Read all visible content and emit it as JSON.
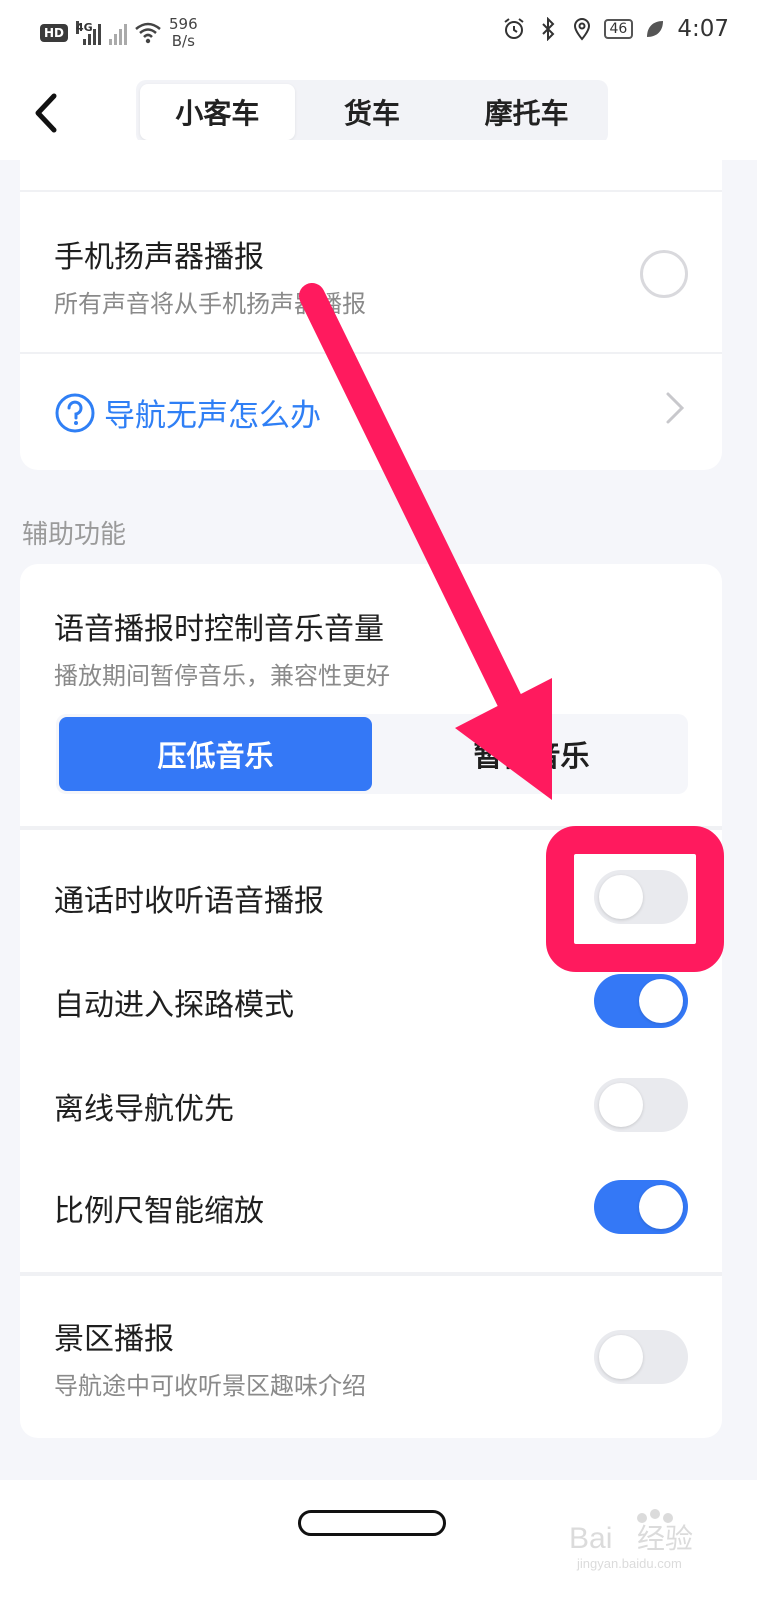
{
  "status_bar": {
    "hd_label": "HD",
    "network_label": "4G",
    "speed_value": "596",
    "speed_unit": "B/s",
    "battery": "46",
    "time": "4:07",
    "icons": [
      "alarm-icon",
      "bluetooth-icon",
      "location-icon",
      "battery-icon",
      "leaf-icon"
    ]
  },
  "header": {
    "tabs": [
      {
        "label": "小客车",
        "active": true
      },
      {
        "label": "货车",
        "active": false
      },
      {
        "label": "摩托车",
        "active": false
      }
    ]
  },
  "card_speaker": {
    "title": "手机扬声器播报",
    "subtitle": "所有声音将从手机扬声器播报",
    "selected": false,
    "help_link": "导航无声怎么办"
  },
  "section_label": "辅助功能",
  "volume_control": {
    "title": "语音播报时控制音乐音量",
    "subtitle": "播放期间暂停音乐，兼容性更好",
    "options": [
      {
        "label": "压低音乐",
        "active": true
      },
      {
        "label": "暂停音乐",
        "active": false
      }
    ]
  },
  "toggles": [
    {
      "label": "通话时收听语音播报",
      "on": false
    },
    {
      "label": "自动进入探路模式",
      "on": true
    },
    {
      "label": "离线导航优先",
      "on": false
    },
    {
      "label": "比例尺智能缩放",
      "on": true
    }
  ],
  "scenic": {
    "title": "景区播报",
    "subtitle": "导航途中可收听景区趣味介绍",
    "on": false
  },
  "watermark": {
    "brand": "Bai",
    "brand2": "经验",
    "url": "jingyan.baidu.com"
  },
  "colors": {
    "accent": "#3478f6",
    "annotation": "#ff1a5e",
    "link": "#2f7ff5",
    "toggle_off": "#e9eaee"
  }
}
